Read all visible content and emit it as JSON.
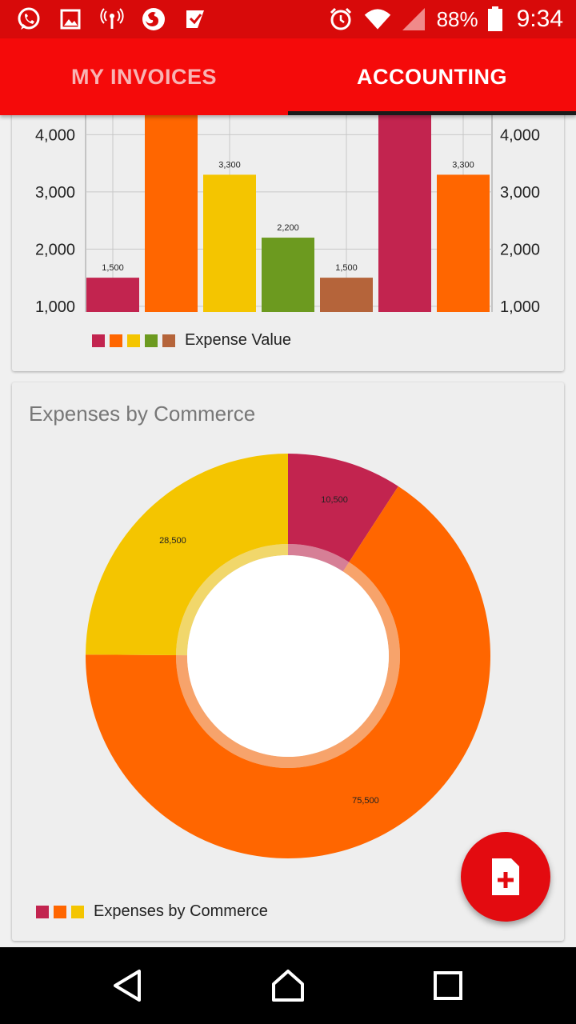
{
  "status_bar": {
    "battery_text": "88%",
    "time": "9:34",
    "left_icons": [
      "whatsapp-icon",
      "image-icon",
      "hotspot-icon",
      "firefox-icon",
      "check-app-icon"
    ],
    "right_icons": [
      "alarm-icon",
      "wifi-icon",
      "signal-icon",
      "battery-icon"
    ]
  },
  "tabs": [
    {
      "label": "MY INVOICES",
      "selected": false
    },
    {
      "label": "ACCOUNTING",
      "selected": true
    }
  ],
  "colors": {
    "status_bar": "#d80a0a",
    "app_bar": "#f50a0a",
    "fab": "#e30b10",
    "crimson": "#c2244f",
    "orange": "#ff6600",
    "yellow": "#f4c500",
    "green": "#6c9a1f",
    "brown": "#b5643a"
  },
  "chart_data": [
    {
      "type": "bar",
      "title": "",
      "categories": [
        "",
        "",
        "",
        "",
        "",
        "",
        ""
      ],
      "values": [
        1500,
        4400,
        3300,
        2200,
        1500,
        4400,
        3300
      ],
      "value_labels": [
        "1,500",
        "",
        "3,300",
        "2,200",
        "1,500",
        "",
        "3,300"
      ],
      "bar_colors": [
        "#c2244f",
        "#ff6600",
        "#f4c500",
        "#6c9a1f",
        "#b5643a",
        "#c2244f",
        "#ff6600"
      ],
      "y_ticks": [
        "1,000",
        "2,000",
        "3,000",
        "4,000"
      ],
      "ylim": [
        900,
        4450
      ],
      "dual_axis": true,
      "grid": true,
      "legend": {
        "label": "Expense Value",
        "colors": [
          "#c2244f",
          "#ff6600",
          "#f4c500",
          "#6c9a1f",
          "#b5643a"
        ],
        "position": "bottom-left"
      }
    },
    {
      "type": "pie",
      "title": "Expenses by Commerce",
      "donut": true,
      "slices": [
        {
          "value": 10500,
          "label": "10,500",
          "color": "#c2244f"
        },
        {
          "value": 75500,
          "label": "75,500",
          "color": "#ff6600"
        },
        {
          "value": 28500,
          "label": "28,500",
          "color": "#f4c500"
        }
      ],
      "legend": {
        "label": "Expenses by Commerce",
        "colors": [
          "#c2244f",
          "#ff6600",
          "#f4c500"
        ],
        "position": "bottom-left"
      }
    }
  ],
  "fab": {
    "icon": "add-document-icon"
  },
  "nav": {
    "icons": [
      "back-icon",
      "home-icon",
      "recents-icon"
    ]
  }
}
